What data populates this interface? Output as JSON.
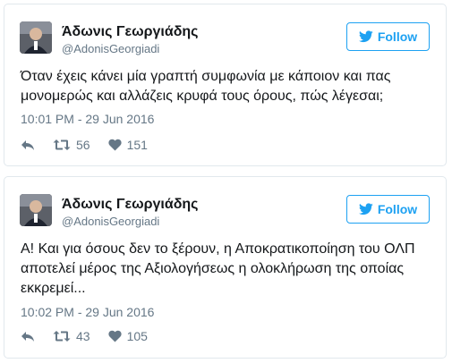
{
  "tweets": [
    {
      "name": "Άδωνις Γεωργιάδης",
      "handle": "@AdonisGeorgiadi",
      "follow_label": "Follow",
      "text": "Όταν έχεις κάνει μία γραπτή συμφωνία με κάποιον και πας μονομερώς και αλλάζεις κρυφά τους όρους, πώς λέγεσαι;",
      "timestamp": "10:01 PM - 29 Jun 2016",
      "retweets": "56",
      "likes": "151"
    },
    {
      "name": "Άδωνις Γεωργιάδης",
      "handle": "@AdonisGeorgiadi",
      "follow_label": "Follow",
      "text": "Α! Και για όσους δεν το ξέρουν, η Αποκρατικοποίηση του ΟΛΠ αποτελεί μέρος της Αξιολογήσεως η ολοκλήρωση της οποίας εκκρεμεί...",
      "timestamp": "10:02 PM - 29 Jun 2016",
      "retweets": "43",
      "likes": "105"
    }
  ],
  "colors": {
    "accent": "#1da1f2",
    "meta_text": "#657786",
    "border": "#e1e8ed"
  },
  "icons": {
    "follow": "twitter-bird-icon",
    "reply": "reply-icon",
    "retweet": "retweet-icon",
    "like": "heart-icon"
  }
}
